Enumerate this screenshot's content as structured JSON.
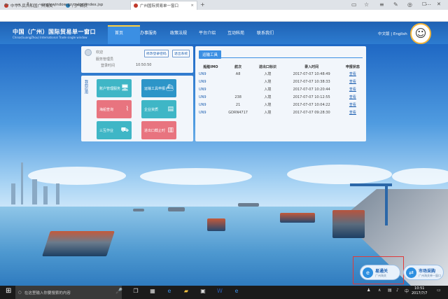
{
  "browser": {
    "tabs": [
      {
        "label": "中华人民共和国广州海关 - ",
        "color": "#c0392b"
      },
      {
        "label": "门户首页",
        "color": "#2980b9"
      },
      {
        "label": "广州国际贸易单一窗口",
        "color": "#c0392b"
      }
    ],
    "url": "singlewindow.gz.cn/gzj/index.jsp"
  },
  "site": {
    "logo_cn": "中国（广州）国际贸易单一窗口",
    "logo_en": "China(GuangZhou) International Trade single window",
    "nav": [
      "首页",
      "办事服务",
      "政策法规",
      "平台介绍",
      "互动科苑",
      "联系我们"
    ],
    "lang": "中文版 | English"
  },
  "user": {
    "name": "欢迎",
    "role": "服务管理员",
    "time_label": "登录时间",
    "time": "10:50:50",
    "btn_change_pwd": "修改登录密码",
    "btn_logout": "退出系统"
  },
  "apps": {
    "title": "我的应用",
    "items": [
      {
        "label": "账户管理服务",
        "color": "#3fb6c6",
        "icon": "monitor-icon"
      },
      {
        "label": "运输工具申报",
        "color": "#2d95c8",
        "icon": "ship-icon"
      },
      {
        "label": "海船查询",
        "color": "#e8747f",
        "icon": "chart-icon"
      },
      {
        "label": "企业资质",
        "color": "#3fb6c6",
        "icon": "id-card-icon"
      },
      {
        "label": "三互作业",
        "color": "#3fb6c6",
        "icon": "truck-icon"
      },
      {
        "label": "进出口截止时",
        "color": "#e8747f",
        "icon": "bar-chart-icon"
      }
    ]
  },
  "records": {
    "tab": "运输工具",
    "headers": [
      "船舶IMO",
      "航次",
      "进出口标识",
      "录入时间",
      "申报状态"
    ],
    "rows": [
      {
        "imo": "UN9",
        "voyage": "A8",
        "flag": "入境",
        "time": "2017-07-07 10:48:49",
        "status": "查看"
      },
      {
        "imo": "UN9",
        "voyage": "",
        "flag": "入境",
        "time": "2017-07-07 10:38:33",
        "status": "查看"
      },
      {
        "imo": "UN9",
        "voyage": "",
        "flag": "入境",
        "time": "2017-07-07 10:20:44",
        "status": "查看"
      },
      {
        "imo": "UN9",
        "voyage": "238",
        "flag": "入境",
        "time": "2017-07-07 10:12:55",
        "status": "查看"
      },
      {
        "imo": "UN9",
        "voyage": "21",
        "flag": "入境",
        "time": "2017-07-07 10:04:22",
        "status": "查看"
      },
      {
        "imo": "UN9",
        "voyage": "GDRN4717",
        "flag": "入境",
        "time": "2017-07-07 09:28:30",
        "status": "查看"
      }
    ]
  },
  "side_buttons": [
    {
      "title": "易通关",
      "subtitle": "广州海关",
      "color": "#2d8fe0"
    },
    {
      "title": "市场采购",
      "subtitle": "广州海关单一窗口",
      "color": "#2d8fe0"
    }
  ],
  "taskbar": {
    "search_placeholder": "在这里输入你要搜索的内容",
    "time": "10:51",
    "date": "2017/7/7"
  }
}
